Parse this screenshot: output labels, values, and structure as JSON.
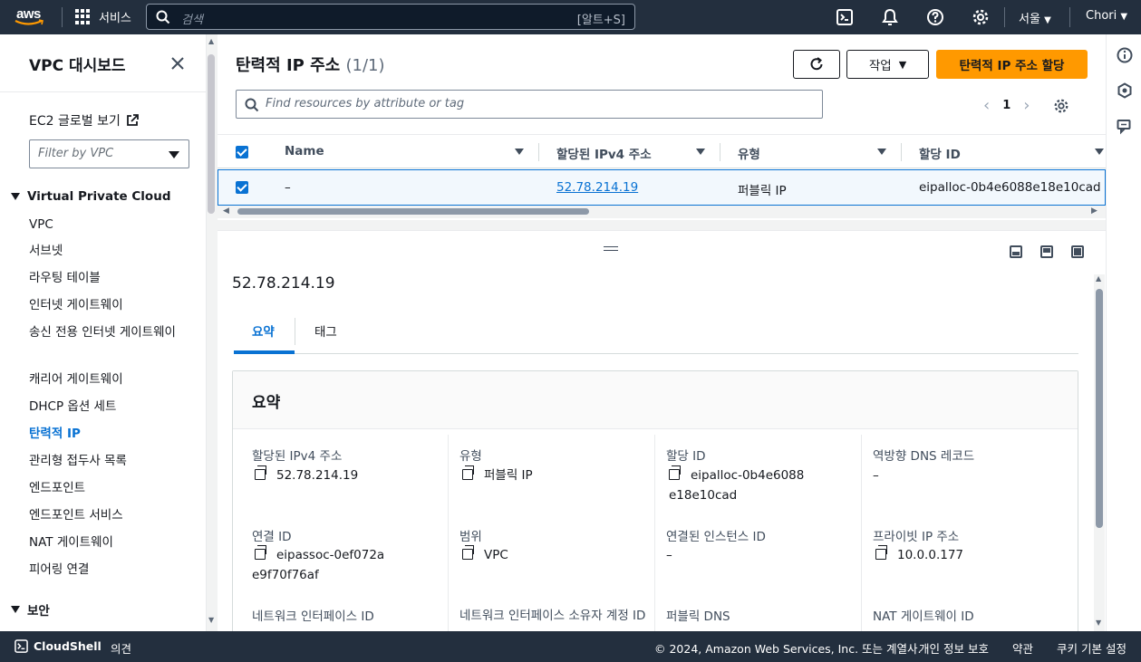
{
  "topnav": {
    "logo_text": "aws",
    "services_label": "서비스",
    "search_placeholder": "검색",
    "search_shortcut": "[알트+S]",
    "region": "서울",
    "user": "Chori"
  },
  "sidebar": {
    "title": "VPC 대시보드",
    "ec2_global": "EC2 글로벌 보기",
    "filter_placeholder": "Filter by VPC",
    "section_vpc": "Virtual Private Cloud",
    "items": [
      "VPC",
      "서브넷",
      "라우팅 테이블",
      "인터넷 게이트웨이",
      "송신 전용 인터넷 게이트웨이",
      "캐리어 게이트웨이",
      "DHCP 옵션 세트",
      "탄력적 IP",
      "관리형 접두사 목록",
      "엔드포인트",
      "엔드포인트 서비스",
      "NAT 게이트웨이",
      "피어링 연결"
    ],
    "active_item": "탄력적 IP",
    "section_security": "보안"
  },
  "header": {
    "title": "탄력적 IP 주소",
    "count": "(1/1)",
    "actions_label": "작업",
    "allocate_label": "탄력적 IP 주소 할당",
    "search_placeholder": "Find resources by attribute or tag",
    "page_number": "1"
  },
  "table": {
    "columns": [
      "Name",
      "할당된 IPv4 주소",
      "유형",
      "할당 ID"
    ],
    "row": {
      "name": "–",
      "ipv4": "52.78.214.19",
      "type": "퍼블릭 IP",
      "allocation_id": "eipalloc-0b4e6088e18e10cad"
    }
  },
  "detail": {
    "ip_title": "52.78.214.19",
    "tabs": [
      "요약",
      "태그"
    ],
    "card_title": "요약",
    "fields": {
      "ipv4_label": "할당된 IPv4 주소",
      "ipv4_value": "52.78.214.19",
      "type_label": "유형",
      "type_value": "퍼블릭 IP",
      "alloc_label": "할당 ID",
      "alloc_value": "eipalloc-0b4e6088e18e10cad",
      "rdns_label": "역방향 DNS 레코드",
      "rdns_value": "–",
      "assoc_label": "연결 ID",
      "assoc_value": "eipassoc-0ef072ae9f70f76af",
      "scope_label": "범위",
      "scope_value": "VPC",
      "instance_label": "연결된 인스턴스 ID",
      "instance_value": "–",
      "private_ip_label": "프라이빗 IP 주소",
      "private_ip_value": "10.0.0.177",
      "eni_label": "네트워크 인터페이스 ID",
      "eni_owner_label": "네트워크 인터페이스 소유자 계정 ID",
      "public_dns_label": "퍼블릭 DNS",
      "nat_label": "NAT 게이트웨이 ID"
    }
  },
  "footer": {
    "cloudshell": "CloudShell",
    "feedback": "의견",
    "copyright": "© 2024, Amazon Web Services, Inc. 또는 계열사.",
    "privacy": "개인 정보 보호",
    "terms": "약관",
    "cookie": "쿠키 기본 설정"
  },
  "colors": {
    "nav_bg": "#232f3e",
    "primary": "#ff9900",
    "link": "#0972d3"
  }
}
